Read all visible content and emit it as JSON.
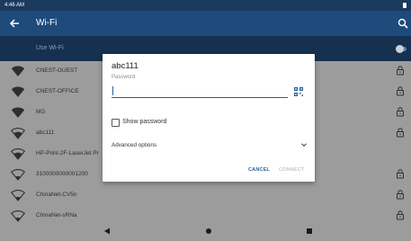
{
  "status_bar": {
    "time": "4:46 AM"
  },
  "toolbar": {
    "title": "Wi-Fi"
  },
  "use_wifi": {
    "label": "Use Wi-Fi",
    "enabled": true
  },
  "networks": [
    {
      "name": "CNEST-GUEST",
      "secured": true,
      "signal": "full",
      "row": 0
    },
    {
      "name": "CNEST-OFFICE",
      "secured": true,
      "signal": "full",
      "row": 1
    },
    {
      "name": "MG",
      "secured": true,
      "signal": "full",
      "row": 2
    },
    {
      "name": "abc111",
      "secured": true,
      "signal": "full-outline",
      "row": 3
    },
    {
      "name": "HP-Print-2F-LaserJet Pr",
      "secured": false,
      "signal": "full-outline",
      "row": 4
    },
    {
      "name": "3100000000001200",
      "secured": true,
      "signal": "outline",
      "row": 5
    },
    {
      "name": "ChinaNet-CV5n",
      "secured": true,
      "signal": "outline",
      "row": 6
    },
    {
      "name": "ChinaNet-sRNa",
      "secured": true,
      "signal": "outline",
      "row": 7
    }
  ],
  "dialog": {
    "title": "abc111",
    "password_label": "Password",
    "password_value": "",
    "show_password_label": "Show password",
    "show_password_checked": false,
    "advanced_options_label": "Advanced options",
    "cancel_label": "CANCEL",
    "connect_label": "CONNECT",
    "accent": "#2b5f97"
  },
  "colors": {
    "toolbar": "#1f4a7c",
    "status_bar": "#1a3a5e",
    "dim_bg": "#9c9c9c"
  }
}
